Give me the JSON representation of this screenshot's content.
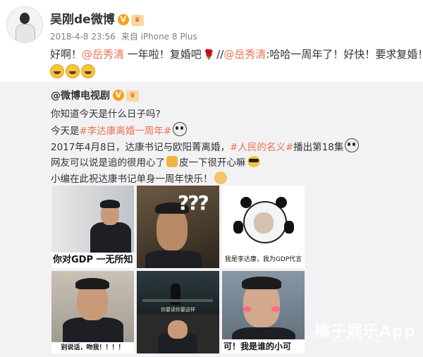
{
  "post": {
    "author": "吴刚de微博",
    "timestamp": "2018-4-8 23:56",
    "source_prefix": "来自",
    "source": "iPhone 8 Plus",
    "text_prefix": "好啊！",
    "mention_1": "@岳秀清",
    "text_mid": " 一年啦！复婚吧",
    "repost_sep": "//",
    "mention_2": "@岳秀清",
    "text_suffix": ":哈哈一周年了！好快！要求复婚！"
  },
  "repost": {
    "author": "@微博电视剧",
    "line1": "你知道今天是什么日子吗?",
    "line2_prefix": "今天是",
    "line2_tag": "#李达康离婚一周年#",
    "line3_prefix": "2017年4月8日，达康书记与欧阳菁离婚，",
    "line3_tag": "#人民的名义#",
    "line3_suffix": "播出第18集",
    "line4_prefix": "网友可以说是追的很用心了",
    "line4_suffix": "皮一下很开心嘛",
    "line5": "小编在此祝达康书记单身一周年快乐！"
  },
  "images": [
    {
      "caption": "你对GDP 一无所知"
    },
    {
      "caption": "???"
    },
    {
      "caption": "我是李达康，我为GDP代言"
    },
    {
      "caption": "别说话，吻我！！！！"
    },
    {
      "caption": "你要读你要这样"
    },
    {
      "caption": "可！我是谁的小可"
    }
  ],
  "watermark": {
    "title": "橘子娱乐App",
    "sub": "HAPPYJUZI.COM"
  },
  "colors": {
    "link": "#eb7350",
    "repost_bg": "#f2f2f5",
    "verified": "#f7a21b"
  },
  "icons": [
    "rose-icon",
    "laugh-cry-icon",
    "thumb-up-icon",
    "sunglasses-icon",
    "panda-icon",
    "cheer-icon",
    "verified-icon",
    "vip-icon"
  ]
}
